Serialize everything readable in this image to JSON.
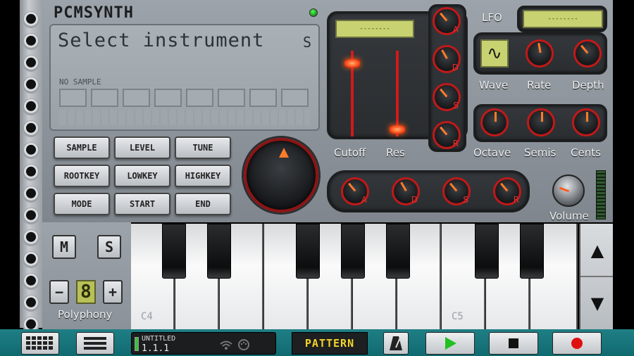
{
  "header": {
    "brand": "PCMSYNTH"
  },
  "lcd": {
    "title": "Select instrument",
    "solo_indicator": "S",
    "no_sample": "NO SAMPLE"
  },
  "param_buttons": [
    "SAMPLE",
    "LEVEL",
    "TUNE",
    "ROOTKEY",
    "LOWKEY",
    "HIGHKEY",
    "MODE",
    "START",
    "END"
  ],
  "filter": {
    "display": "--------",
    "cutoff_label": "Cutoff",
    "res_label": "Res",
    "cutoff_level": 0.85,
    "res_level": 0.08,
    "env_knobs": [
      "A",
      "D",
      "S",
      "R"
    ]
  },
  "lfo": {
    "label": "LFO",
    "display": "--------",
    "wave_label": "Wave",
    "rate_label": "Rate",
    "depth_label": "Depth",
    "wave_icon": "sine-wave-icon"
  },
  "pitch": {
    "octave_label": "Octave",
    "semis_label": "Semis",
    "cents_label": "Cents"
  },
  "amp_env": [
    "A",
    "D",
    "S",
    "R"
  ],
  "volume": {
    "label": "Volume"
  },
  "keys_panel": {
    "mute": "M",
    "solo": "S",
    "minus": "−",
    "plus": "+",
    "polyphony_value": "8",
    "polyphony_label": "Polyphony"
  },
  "keyboard": {
    "label_c4": "C4",
    "label_c5": "C5"
  },
  "octave_buttons": {
    "up": "▲",
    "down": "▼"
  },
  "toolbar": {
    "song_title": "UNTITLED",
    "song_position": "1.1.1",
    "pattern_label": "PATTERN"
  },
  "colors": {
    "accent_red": "#c11919",
    "lcd_green": "#c8d270",
    "toolbar_teal": "#1f7f85",
    "play_green": "#22c022",
    "record_red": "#e01010"
  }
}
